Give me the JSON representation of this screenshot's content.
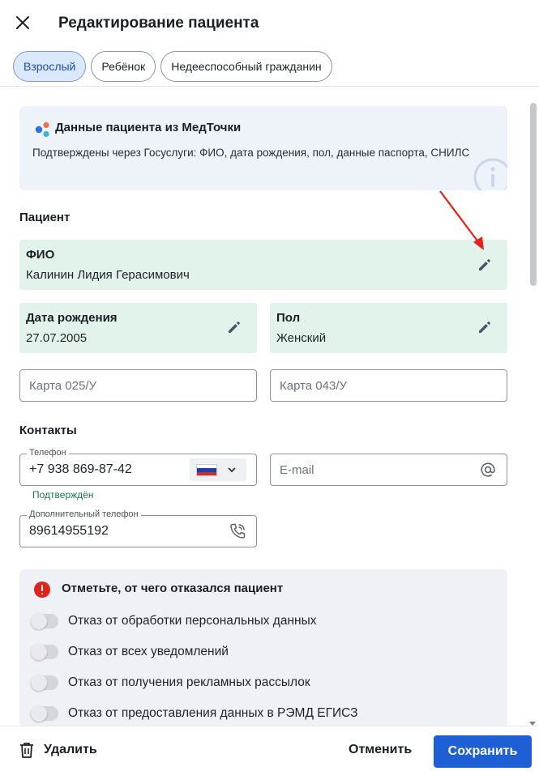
{
  "header": {
    "title": "Редактирование пациента"
  },
  "tabs": [
    {
      "label": "Взрослый",
      "active": true
    },
    {
      "label": "Ребёнок",
      "active": false
    },
    {
      "label": "Недееспособный гражданин",
      "active": false
    }
  ],
  "info_card": {
    "title": "Данные пациента из МедТочки",
    "text": "Подтверждены через Госуслуги: ФИО, дата рождения, пол, данные паспорта, СНИЛС"
  },
  "patient_section": {
    "label": "Пациент",
    "fio": {
      "label": "ФИО",
      "value": "Калинин Лидия Герасимович"
    },
    "birth_date": {
      "label": "Дата рождения",
      "value": "27.07.2005"
    },
    "gender": {
      "label": "Пол",
      "value": "Женский"
    },
    "card_025": {
      "placeholder": "Карта 025/У"
    },
    "card_043": {
      "placeholder": "Карта 043/У"
    }
  },
  "contacts_section": {
    "label": "Контакты",
    "phone": {
      "label": "Телефон",
      "value": "+7 938 869-87-42",
      "status": "Подтверждён",
      "country": "RU"
    },
    "email": {
      "placeholder": "E-mail"
    },
    "extra_phone": {
      "label": "Дополнительный телефон",
      "value": "89614955192"
    }
  },
  "refusals": {
    "title": "Отметьте, от чего отказался пациент",
    "items": [
      {
        "label": "Отказ от обработки персональных данных",
        "checked": false
      },
      {
        "label": "Отказ от всех уведомлений",
        "checked": false
      },
      {
        "label": "Отказ от получения рекламных рассылок",
        "checked": false
      },
      {
        "label": "Отказ от предоставления данных в РЭМД ЕГИСЗ",
        "checked": false
      }
    ]
  },
  "footer": {
    "delete_label": "Удалить",
    "cancel_label": "Отменить",
    "save_label": "Сохранить"
  },
  "colors": {
    "accent": "#1f5fd6",
    "confirmed_field_bg": "#e2f3ec",
    "active_tab_bg": "#dbe7fb",
    "alert": "#e2231a",
    "annotation_arrow": "#e8201a"
  }
}
